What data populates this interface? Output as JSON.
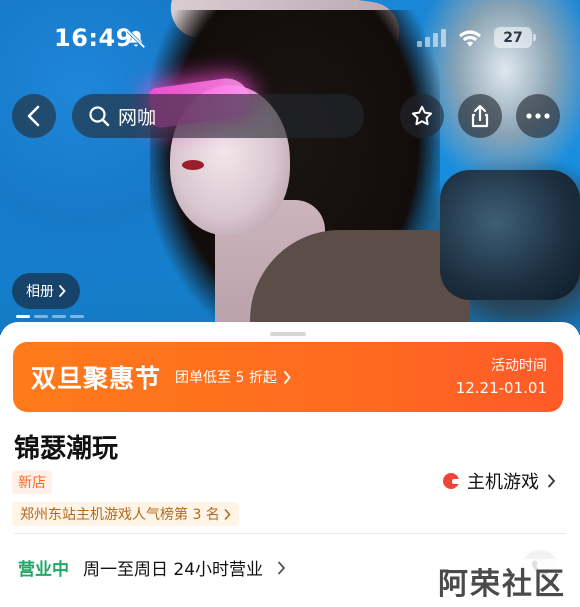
{
  "status_bar": {
    "time": "16:49",
    "battery": "27"
  },
  "nav": {
    "search_text": "网咖"
  },
  "hero": {
    "album_label": "相册",
    "photo_count": 4,
    "active_photo": 1
  },
  "promo": {
    "title": "双旦聚惠节",
    "subtitle": "团单低至 5 折起",
    "time_label": "活动时间",
    "time_range": "12.21-01.01"
  },
  "shop": {
    "name": "锦瑟潮玩",
    "new_tag": "新店",
    "category": "主机游戏",
    "rank": "郑州东站主机游戏人气榜第 3 名"
  },
  "hours": {
    "status": "营业中",
    "schedule": "周一至周日 24小时营业"
  },
  "watermark": "阿荣社区",
  "colors": {
    "promo": "#ff6b1f",
    "open": "#1fa865",
    "tag": "#ff6a2b",
    "rank": "#b4691d"
  }
}
